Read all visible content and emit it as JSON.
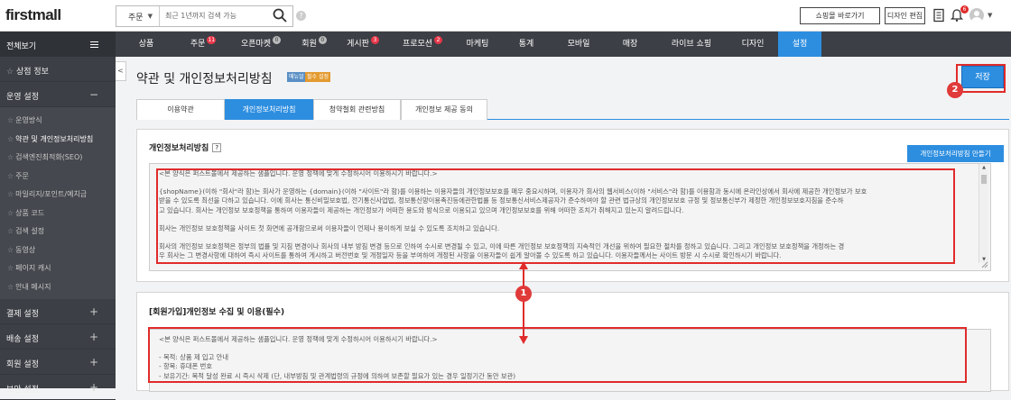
{
  "header": {
    "logo": "firstmall",
    "search_scope": "주문",
    "search_placeholder": "최근 1년까지 검색 가능",
    "help": "?",
    "shop_button": "쇼핑몰 바로가기",
    "design_button": "디자인 편집",
    "notification_count": "6"
  },
  "sidebar": {
    "all_label": "전체보기",
    "shop_info": "상점 정보",
    "ops_section": "운영 설정",
    "ops_items": [
      "운영방식",
      "약관 및 개인정보처리방침",
      "검색엔진최적화(SEO)",
      "주문",
      "마일리지/포인트/예치금",
      "상품 코드",
      "검색 설정",
      "동영상",
      "페이지 캐시",
      "안내 메시지"
    ],
    "bottom_sections": [
      "결제 설정",
      "배송 설정",
      "회원 설정",
      "보안 설정"
    ]
  },
  "nav": {
    "items": [
      {
        "label": "상품",
        "badge": ""
      },
      {
        "label": "주문",
        "badge": "11"
      },
      {
        "label": "오픈마켓",
        "badge": "0"
      },
      {
        "label": "회원",
        "badge": "0"
      },
      {
        "label": "게시판",
        "badge": "3"
      },
      {
        "label": "프로모션",
        "badge": "2"
      },
      {
        "label": "마케팅",
        "badge": ""
      },
      {
        "label": "통계",
        "badge": ""
      },
      {
        "label": "모바일",
        "badge": ""
      },
      {
        "label": "매장",
        "badge": ""
      },
      {
        "label": "라이브 쇼핑",
        "badge": ""
      },
      {
        "label": "디자인",
        "badge": ""
      },
      {
        "label": "설정",
        "badge": ""
      }
    ]
  },
  "page": {
    "title": "약관 및 개인정보처리방침",
    "tag_manual": "매뉴얼",
    "tag_required": "필수 설정",
    "save_button": "저장",
    "marker_save": "2",
    "marker_arrow": "1"
  },
  "tabs": [
    "이용약관",
    "개인정보처리방침",
    "청약철회 관련방침",
    "개인정보 제공 동의"
  ],
  "privacy": {
    "title": "개인정보처리방침",
    "help": "?",
    "make_button": "개인정보처리방침 만들기",
    "notice": "<본 양식은 퍼스트몰에서 제공하는 샘플입니다. 운영 정책에 맞게 수정하시어 이용하시기 바랍니다.>",
    "para1_line1": "{shopName}(이하 \"회사\"라 함)는 회사가 운영하는 {domain}(이하 \"사이트\"라 함)를 이용하는 이용자들의 개인정보보호를 매우 중요시하며, 이용자가 회사의 웹서비스(이하 \"서비스\"라 함)를 이용함과 동시에 온라인상에서 회사에 제공한 개인정보가 보호",
    "para1_line2": "받을 수 있도록 최선을 다하고 있습니다. 이에 회사는 통신비밀보호법, 전기통신사업법, 정보통신망이용촉진등에관한법률 등 정보통신서비스제공자가 준수하여야 할 관련 법규상의 개인정보보호 규정 및 정보통신부가 제정한 개인정보보호지침을 준수하",
    "para1_line3": "고 있습니다. 회사는 개인정보 보호정책을 통하여 이용자들이 제공하는 개인정보가 어떠한 용도와 방식으로 이용되고 있으며 개인정보보호를 위해 어떠한 조치가 취해지고 있는지 알려드립니다.",
    "para2": "회사는 개인정보 보호정책을 사이트 첫 화면에 공개함으로써 이용자들이 언제나 용이하게 보실 수 있도록 조치하고 있습니다.",
    "para3_line1": "회사의 개인정보 보호정책은 정부의 법률 및 지침 변경이나 회사의 내부 방침 변경 등으로 인하여 수시로 변경될 수 있고, 이에 따른 개인정보 보호정책의 지속적인 개선을 위하여 필요한 절차를 정하고 있습니다. 그리고 개인정보 보호정책을 개정하는 경",
    "para3_line2": "우 회사는 그 변경사항에 대하여 즉시 사이트를 통하여 게시하고 버전번호 및 개정일자 등을 부여하여 개정된 사항을 이용자들이 쉽게 알아볼 수 있도록 하고 있습니다. 이용자들께서는 사이트 방문 시 수시로 확인하시기 바랍니다."
  },
  "member": {
    "title": "[회원가입]개인정보 수집 및 이용(필수)",
    "notice": "<본 양식은 퍼스트몰에서 제공하는 샘플입니다. 운영 정책에 맞게 수정하시어 이용하시기 바랍니다.>",
    "line1": "- 목적: 상품 제 입고 안내",
    "line2": "- 항목: 휴대폰 번호",
    "line3": "- 보유기간: 목적 달성 완료 시 즉시 삭제 (단, 내부방침 및 관계법령의 규정에 의하여 보존할 필요가 있는 경우 일정기간 동안 보관)"
  },
  "colors": {
    "accent": "#2d8ee0",
    "highlight": "#e02b2b",
    "sidebar_bg": "#3c3f45"
  }
}
